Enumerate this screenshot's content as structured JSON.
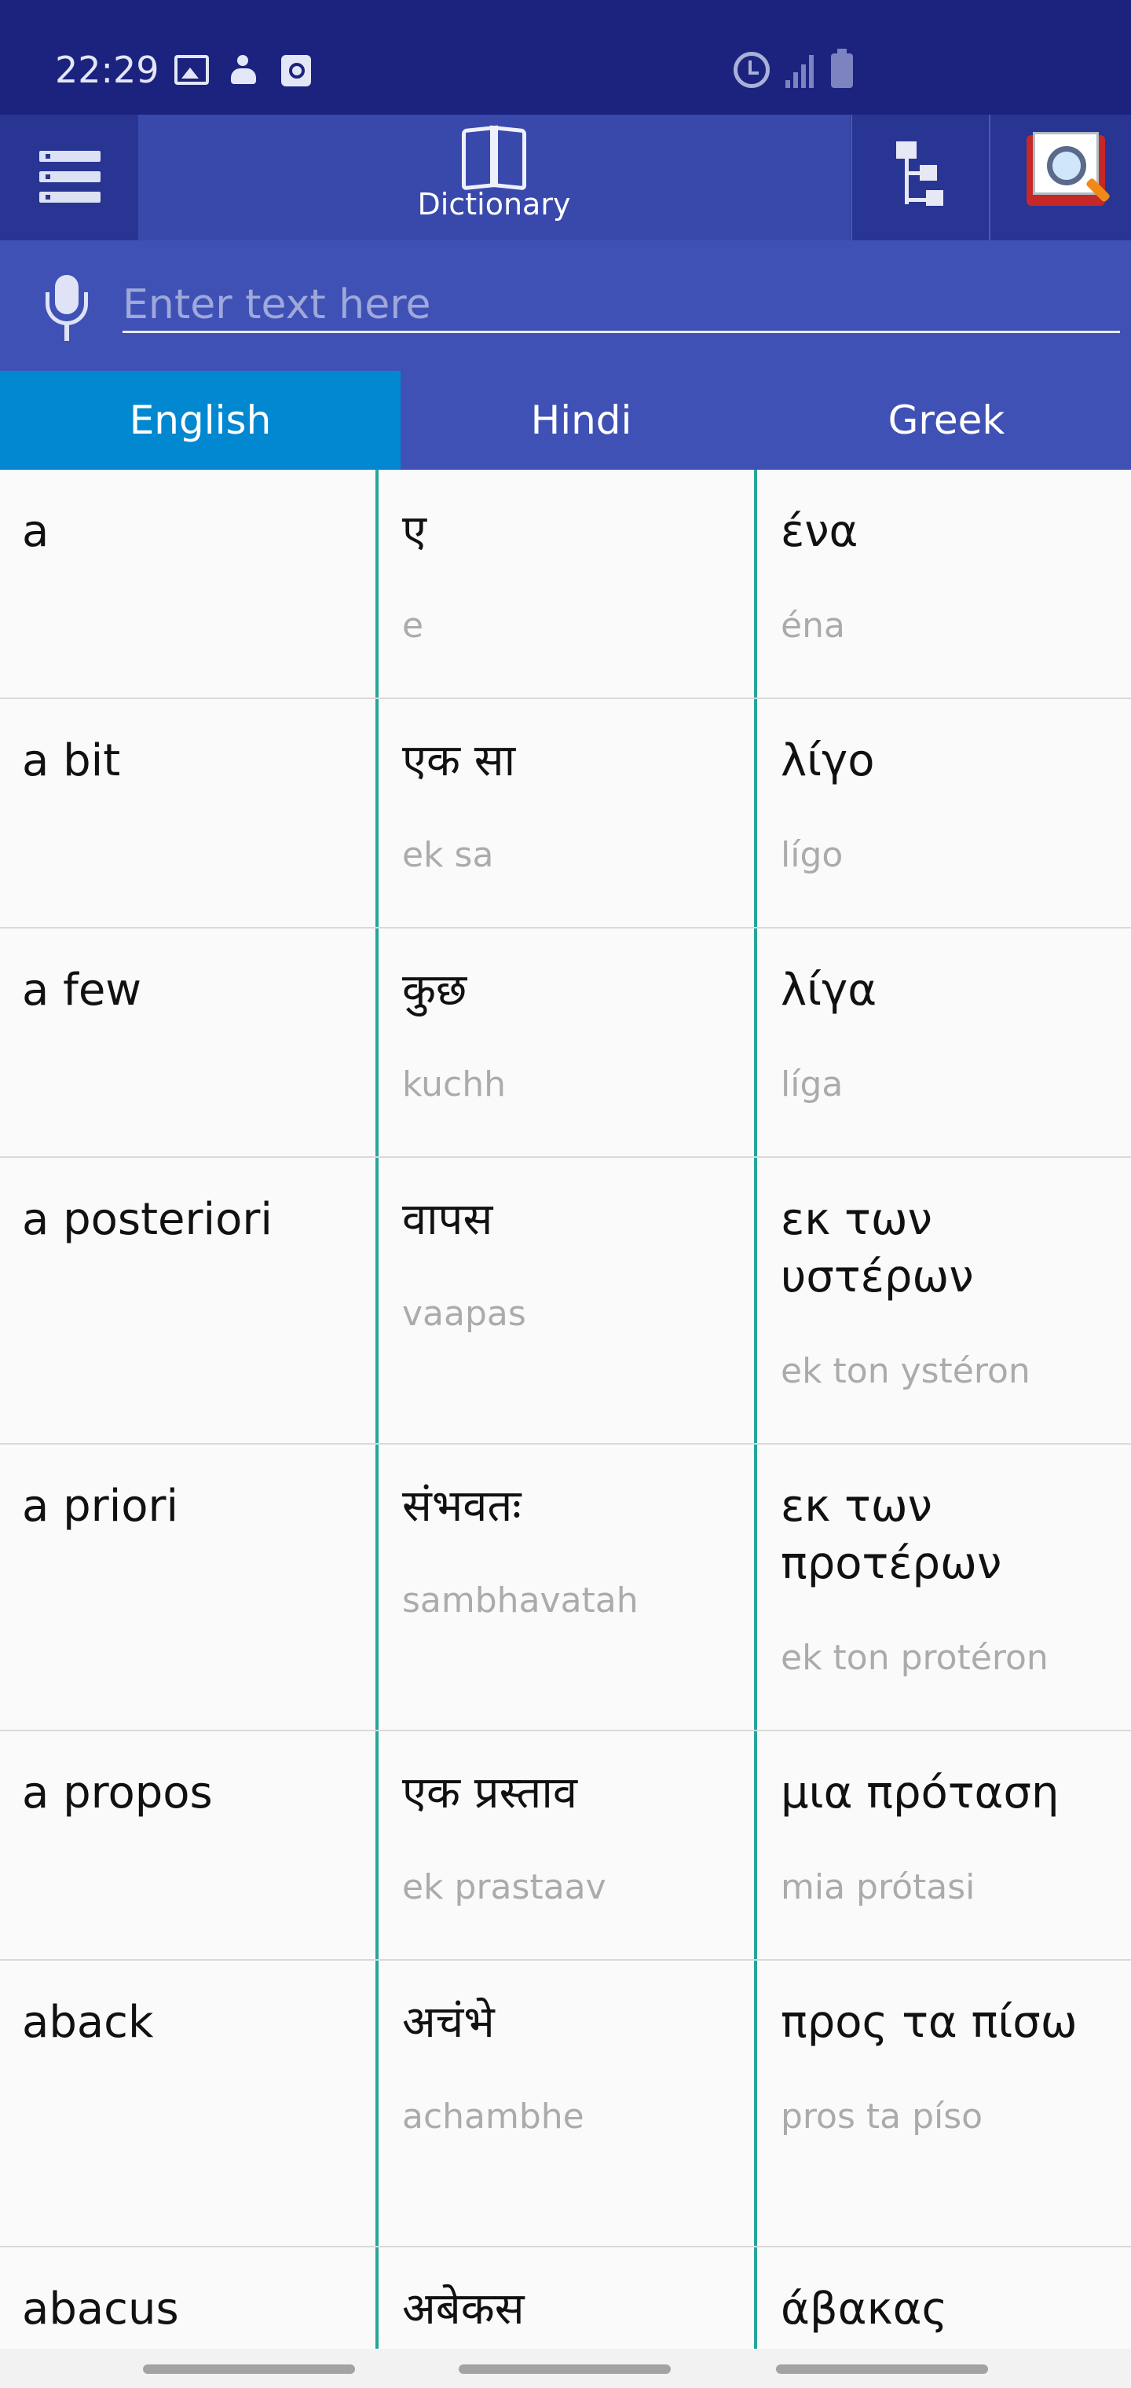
{
  "status_bar": {
    "time": "22:29",
    "left_icons": [
      "gallery-icon",
      "person-icon",
      "app-icon"
    ],
    "right_icons": [
      "alarm-icon",
      "signal-icon",
      "battery-icon"
    ]
  },
  "toolbar": {
    "menu_icon": "menu-icon",
    "dictionary_label": "Dictionary",
    "dictionary_icon": "book-icon",
    "tree_icon": "tree-icon",
    "search_dictionary_icon": "dictionary-search-icon"
  },
  "search": {
    "placeholder": "Enter text here",
    "value": "",
    "mic_icon": "microphone-icon"
  },
  "language_tabs": [
    {
      "label": "English",
      "active": true
    },
    {
      "label": "Hindi",
      "active": false
    },
    {
      "label": "Greek",
      "active": false
    }
  ],
  "colors": {
    "status_bar": "#1b237f",
    "toolbar": "#283593",
    "active_tab": "#3949ab",
    "search_bar": "#3f51b5",
    "active_language_tab": "#0288d1",
    "column_divider": "#26a69a",
    "transliteration_text": "#ababab"
  },
  "entries": [
    {
      "en": "a",
      "hi": "ए",
      "hi_tr": "e",
      "el": "ένα",
      "el_tr": "éna"
    },
    {
      "en": "a bit",
      "hi": "एक सा",
      "hi_tr": "ek sa",
      "el": "λίγο",
      "el_tr": "lígo"
    },
    {
      "en": "a few",
      "hi": "कुछ",
      "hi_tr": "kuchh",
      "el": "λίγα",
      "el_tr": "líga"
    },
    {
      "en": "a posteriori",
      "hi": "वापस",
      "hi_tr": "vaapas",
      "el": "εκ των υστέρων",
      "el_tr": "ek ton ystéron"
    },
    {
      "en": "a priori",
      "hi": "संभवतः",
      "hi_tr": "sambhavatah",
      "el": "εκ των προτέρων",
      "el_tr": "ek ton protéron"
    },
    {
      "en": "a propos",
      "hi": "एक प्रस्ताव",
      "hi_tr": "ek prastaav",
      "el": "μια πρόταση",
      "el_tr": "mia prótasi"
    },
    {
      "en": "aback",
      "hi": "अचंभे",
      "hi_tr": "achambhe",
      "el": "προς τα πίσω",
      "el_tr": "pros ta píso"
    },
    {
      "en": "abacus",
      "hi": "अबेकस",
      "hi_tr": "",
      "el": "άβακας",
      "el_tr": ""
    }
  ]
}
